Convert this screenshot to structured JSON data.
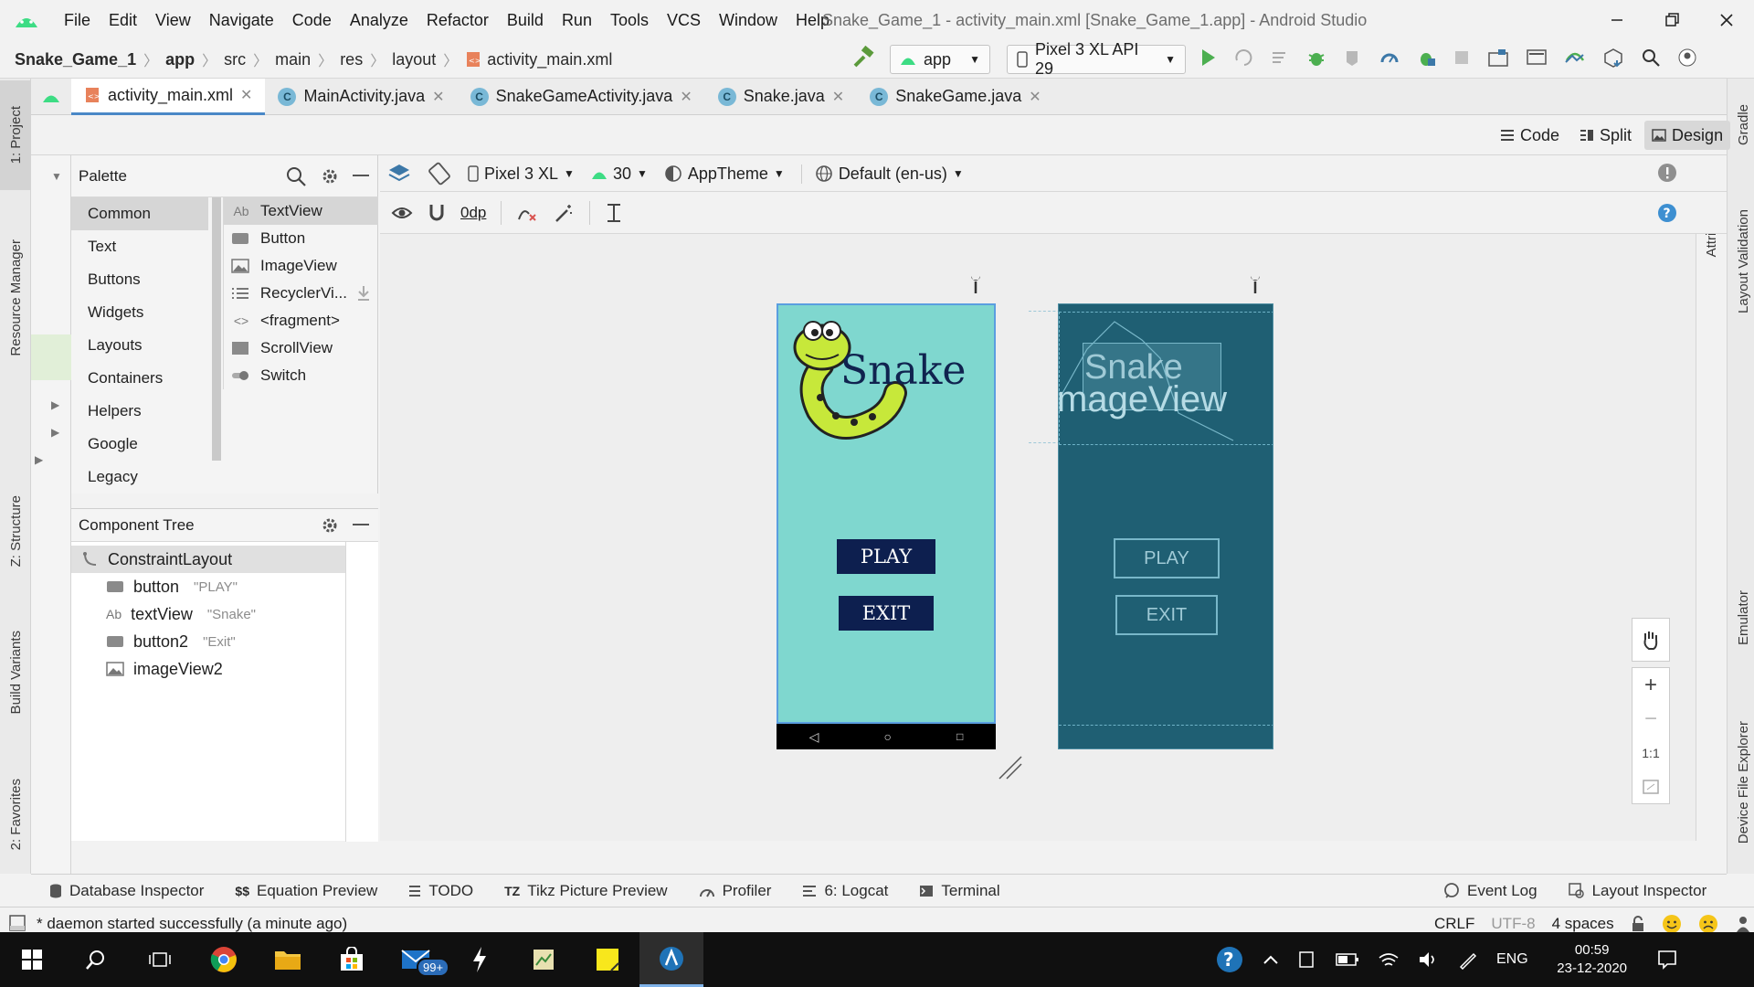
{
  "window": {
    "title": "Snake_Game_1 - activity_main.xml [Snake_Game_1.app] - Android Studio",
    "menu": [
      "File",
      "Edit",
      "View",
      "Navigate",
      "Code",
      "Analyze",
      "Refactor",
      "Build",
      "Run",
      "Tools",
      "VCS",
      "Window",
      "Help"
    ]
  },
  "breadcrumb": [
    "Snake_Game_1",
    "app",
    "src",
    "main",
    "res",
    "layout",
    "activity_main.xml"
  ],
  "toolbar": {
    "run_config": "app",
    "device": "Pixel 3 XL API 29"
  },
  "editor_tabs": [
    {
      "label": "activity_main.xml",
      "active": true
    },
    {
      "label": "MainActivity.java"
    },
    {
      "label": "SnakeGameActivity.java"
    },
    {
      "label": "Snake.java"
    },
    {
      "label": "SnakeGame.java"
    }
  ],
  "view_modes": {
    "code": "Code",
    "split": "Split",
    "design": "Design",
    "active": "Design"
  },
  "palette": {
    "title": "Palette",
    "categories": [
      "Common",
      "Text",
      "Buttons",
      "Widgets",
      "Layouts",
      "Containers",
      "Helpers",
      "Google",
      "Legacy"
    ],
    "active_category": "Common",
    "items": [
      {
        "label": "TextView",
        "icon": "textview-icon"
      },
      {
        "label": "Button",
        "icon": "button-icon"
      },
      {
        "label": "ImageView",
        "icon": "imageview-icon"
      },
      {
        "label": "RecyclerVi...",
        "icon": "recyclerview-icon"
      },
      {
        "label": "<fragment>",
        "icon": "fragment-icon"
      },
      {
        "label": "ScrollView",
        "icon": "scrollview-icon"
      },
      {
        "label": "Switch",
        "icon": "switch-icon"
      }
    ]
  },
  "design_toolbar": {
    "device": "Pixel 3 XL",
    "api": "30",
    "theme": "AppTheme",
    "locale": "Default (en-us)",
    "margin": "0dp"
  },
  "component_tree": {
    "title": "Component Tree",
    "root": "ConstraintLayout",
    "children": [
      {
        "name": "button",
        "hint": "\"PLAY\""
      },
      {
        "name": "textView",
        "hint": "\"Snake\""
      },
      {
        "name": "button2",
        "hint": "\"Exit\""
      },
      {
        "name": "imageView2",
        "hint": ""
      }
    ]
  },
  "preview": {
    "title_text": "Snake",
    "play_button": "PLAY",
    "exit_button": "EXIT",
    "blueprint_title": "Snake",
    "blueprint_image_label": "mageView",
    "blueprint_play": "PLAY",
    "blueprint_exit": "EXIT",
    "colors": {
      "screen_bg": "#7fd7cf",
      "button_bg": "#0d1f4f",
      "blueprint_bg": "#1f5f73"
    }
  },
  "zoom_controls": {
    "fit_label": "1:1"
  },
  "left_stripe": [
    "1: Project",
    "Resource Manager",
    "Z: Structure",
    "Build Variants",
    "2: Favorites"
  ],
  "right_stripe": [
    "Gradle",
    "Attributes",
    "Layout Validation",
    "Emulator",
    "Device File Explorer"
  ],
  "tool_windows": [
    "Database Inspector",
    "Equation Preview",
    "TODO",
    "Tikz Picture Preview",
    "Profiler",
    "6: Logcat",
    "Terminal"
  ],
  "tool_windows_right": [
    "Event Log",
    "Layout Inspector"
  ],
  "status": {
    "message": "* daemon started successfully (a minute ago)",
    "line_sep": "CRLF",
    "encoding": "UTF-8",
    "indent": "4 spaces"
  },
  "taskbar": {
    "mail_badge": "99+",
    "lang": "ENG",
    "time": "00:59",
    "date": "23-12-2020"
  }
}
